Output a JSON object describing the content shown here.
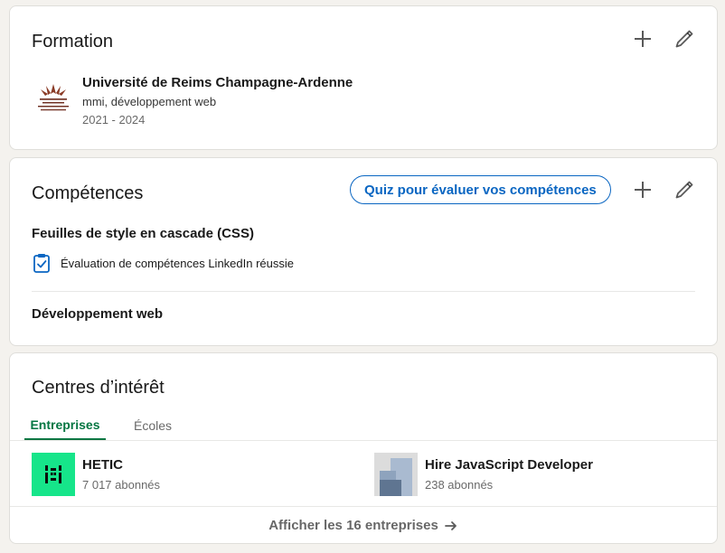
{
  "formation": {
    "title": "Formation",
    "entry": {
      "school": "Université de Reims Champagne-Ardenne",
      "degree": "mmi, développement web",
      "dates": "2021 - 2024",
      "logo_icon": "university-logo",
      "logo_color": "#7a2e22"
    },
    "add_icon": "plus-icon",
    "edit_icon": "pencil-icon"
  },
  "skills": {
    "title": "Compétences",
    "quiz_label": "Quiz pour évaluer vos compétences",
    "items": [
      {
        "name": "Feuilles de style en cascade (CSS)",
        "badge_icon": "clipboard-check-icon",
        "badge_text": "Évaluation de compétences LinkedIn réussie"
      },
      {
        "name": "Développement web"
      }
    ],
    "accent_color": "#0a66c2"
  },
  "interests": {
    "title": "Centres d’intérêt",
    "tabs": [
      {
        "label": "Entreprises",
        "active": true
      },
      {
        "label": "Écoles",
        "active": false
      }
    ],
    "active_color": "#057642",
    "companies": [
      {
        "name": "HETIC",
        "followers": "7 017 abonnés",
        "logo_color": "#16e58a"
      },
      {
        "name": "Hire JavaScript Developer",
        "followers": "238 abonnés",
        "logo_color": "#a8b8cc"
      }
    ],
    "show_all_label": "Afficher les 16 entreprises",
    "arrow_icon": "arrow-right-icon"
  }
}
